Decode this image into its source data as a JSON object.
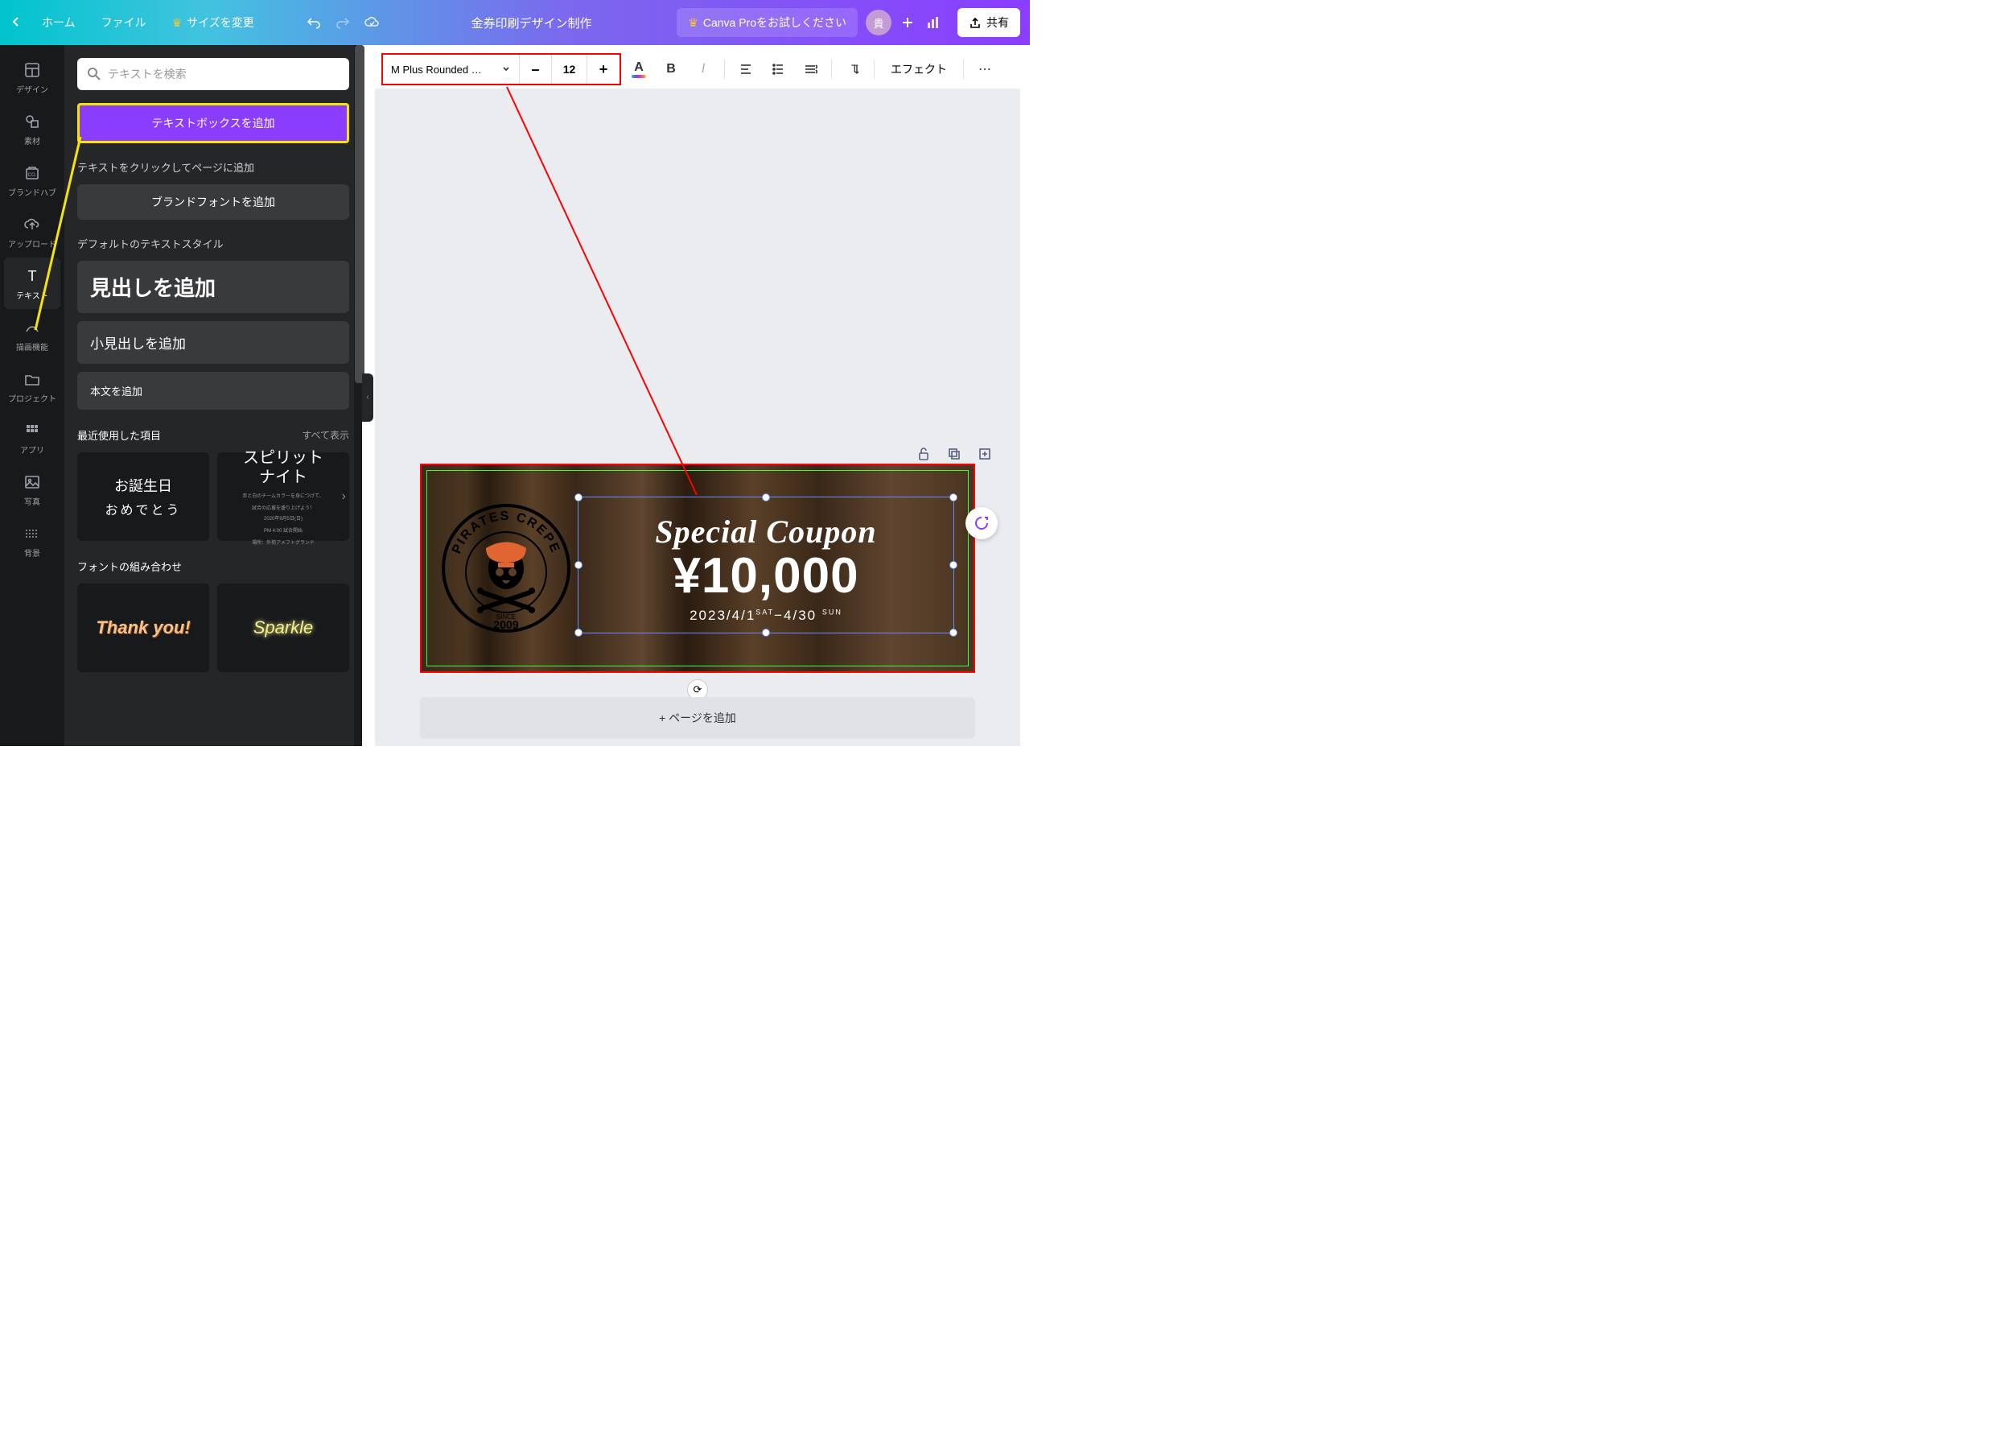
{
  "header": {
    "home": "ホーム",
    "file": "ファイル",
    "resize": "サイズを変更",
    "title": "金券印刷デザイン制作",
    "pro": "Canva Proをお試しください",
    "avatar": "貴",
    "share": "共有"
  },
  "rail": {
    "design": "デザイン",
    "elements": "素材",
    "brand": "ブランドハブ",
    "upload": "アップロード",
    "text": "テキスト",
    "draw": "描画機能",
    "projects": "プロジェクト",
    "apps": "アプリ",
    "photos": "写真",
    "background": "背景"
  },
  "panel": {
    "search_placeholder": "テキストを検索",
    "add_text": "テキストボックスを追加",
    "click_hint": "テキストをクリックしてページに追加",
    "brand_fonts": "ブランドフォントを追加",
    "default_styles": "デフォルトのテキストスタイル",
    "h1": "見出しを追加",
    "h2": "小見出しを追加",
    "body": "本文を追加",
    "recent": "最近使用した項目",
    "see_all": "すべて表示",
    "combos": "フォントの組み合わせ",
    "t_bday1": "お誕生日",
    "t_bday2": "おめでとう",
    "t_spirit": "スピリット\nナイト",
    "t_spirit_meta1": "赤と白のチームカラーを身につけて、",
    "t_spirit_meta2": "試合の応援を盛り上げよう！",
    "t_spirit_meta3": "2020年9月5日(日)",
    "t_spirit_meta4": "PM 4:00 試合開始",
    "t_spirit_meta5": "場所：外苑アメフトグランド",
    "t_thanks": "Thank you!",
    "t_sparkle": "Sparkle"
  },
  "toolbar": {
    "font": "M Plus Rounded …",
    "size": "12",
    "effects": "エフェクト"
  },
  "coupon": {
    "logo_top": "PIRATES CREPE",
    "logo_since": "SINCE",
    "logo_year": "2009",
    "special": "Special Coupon",
    "amount": "¥10,000",
    "dates_a": "2023/4/1",
    "dates_sat": "SAT",
    "dates_b": "−4/30",
    "dates_sun": "SUN"
  },
  "canvas": {
    "add_page": "+ ページを追加"
  }
}
